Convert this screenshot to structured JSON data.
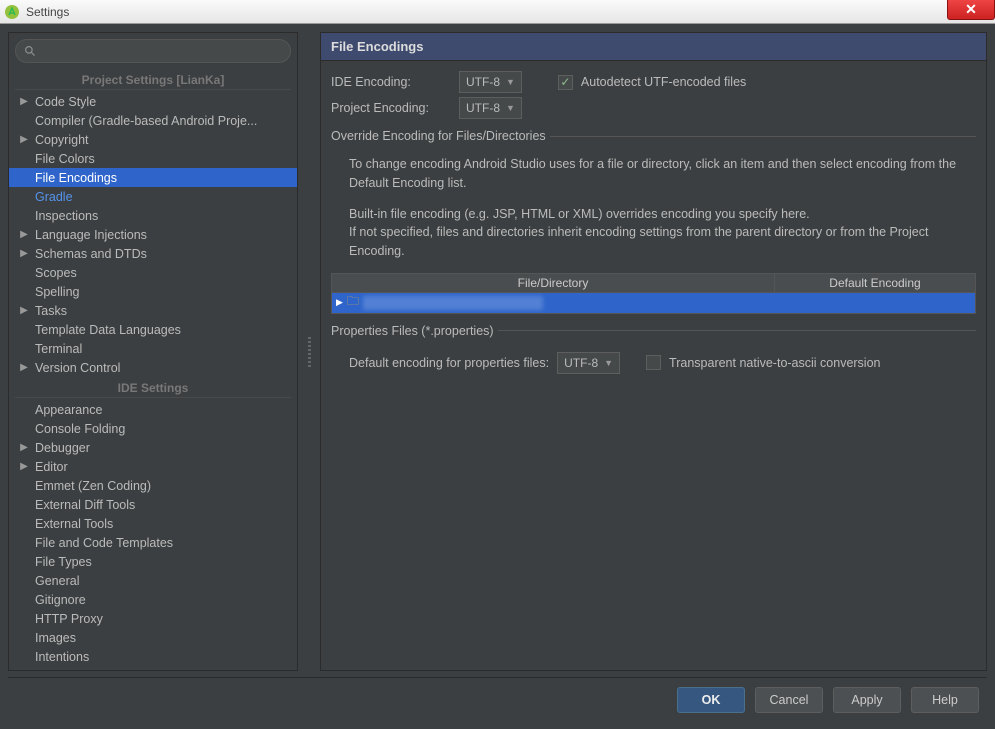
{
  "window": {
    "title": "Settings"
  },
  "search": {
    "placeholder": ""
  },
  "sidebar": {
    "section1": "Project Settings [LianKa]",
    "section2": "IDE Settings",
    "items1": [
      {
        "label": "Code Style",
        "arrow": true
      },
      {
        "label": "Compiler (Gradle-based Android Proje...",
        "arrow": false
      },
      {
        "label": "Copyright",
        "arrow": true
      },
      {
        "label": "File Colors",
        "arrow": false
      },
      {
        "label": "File Encodings",
        "arrow": false,
        "selected": true
      },
      {
        "label": "Gradle",
        "arrow": false,
        "blue": true
      },
      {
        "label": "Inspections",
        "arrow": false
      },
      {
        "label": "Language Injections",
        "arrow": true
      },
      {
        "label": "Schemas and DTDs",
        "arrow": true
      },
      {
        "label": "Scopes",
        "arrow": false
      },
      {
        "label": "Spelling",
        "arrow": false
      },
      {
        "label": "Tasks",
        "arrow": true
      },
      {
        "label": "Template Data Languages",
        "arrow": false
      },
      {
        "label": "Terminal",
        "arrow": false
      },
      {
        "label": "Version Control",
        "arrow": true
      }
    ],
    "items2": [
      {
        "label": "Appearance",
        "arrow": false
      },
      {
        "label": "Console Folding",
        "arrow": false
      },
      {
        "label": "Debugger",
        "arrow": true
      },
      {
        "label": "Editor",
        "arrow": true
      },
      {
        "label": "Emmet (Zen Coding)",
        "arrow": false
      },
      {
        "label": "External Diff Tools",
        "arrow": false
      },
      {
        "label": "External Tools",
        "arrow": false
      },
      {
        "label": "File and Code Templates",
        "arrow": false
      },
      {
        "label": "File Types",
        "arrow": false
      },
      {
        "label": "General",
        "arrow": false
      },
      {
        "label": "Gitignore",
        "arrow": false
      },
      {
        "label": "HTTP Proxy",
        "arrow": false
      },
      {
        "label": "Images",
        "arrow": false
      },
      {
        "label": "Intentions",
        "arrow": false
      }
    ]
  },
  "panel": {
    "title": "File Encodings",
    "ide_label": "IDE Encoding:",
    "ide_value": "UTF-8",
    "project_label": "Project Encoding:",
    "project_value": "UTF-8",
    "autodetect_label": "Autodetect UTF-encoded files",
    "autodetect_checked": true,
    "override_legend": "Override Encoding for Files/Directories",
    "help1": "To change encoding Android Studio uses for a file or directory, click an item and then select encoding from the Default Encoding list.",
    "help2": "Built-in file encoding (e.g. JSP, HTML or XML) overrides encoding you specify here.",
    "help3": "If not specified, files and directories inherit encoding settings from the parent directory or from the Project Encoding.",
    "col1": "File/Directory",
    "col2": "Default Encoding",
    "props_legend": "Properties Files (*.properties)",
    "props_label": "Default encoding for properties files:",
    "props_value": "UTF-8",
    "transparent_label": "Transparent native-to-ascii conversion"
  },
  "buttons": {
    "ok": "OK",
    "cancel": "Cancel",
    "apply": "Apply",
    "help": "Help"
  }
}
